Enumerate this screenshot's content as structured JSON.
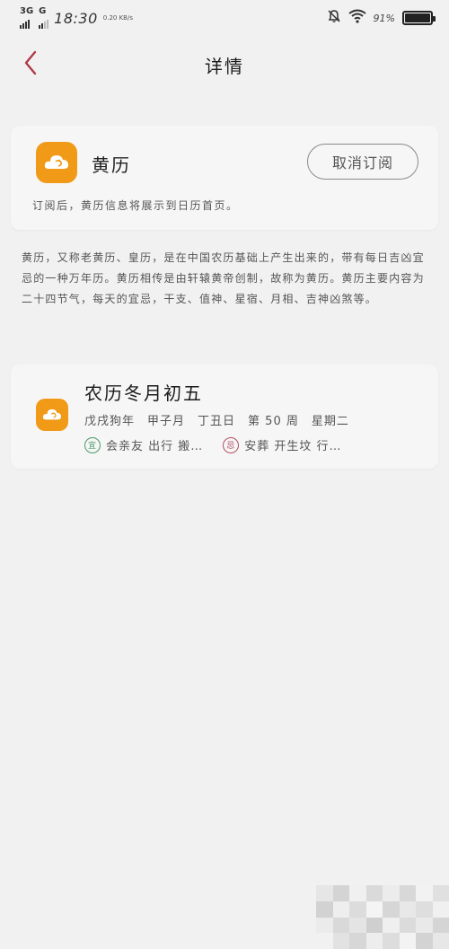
{
  "status_bar": {
    "network": "3G",
    "network2": "G",
    "time": "18:30",
    "speed": "0.20 KB/s",
    "battery": "91%"
  },
  "header": {
    "title": "详情",
    "back_icon": "chevron-left-icon"
  },
  "subscription": {
    "app_name": "黄历",
    "unsubscribe_label": "取消订阅",
    "note": "订阅后，黄历信息将展示到日历首页。"
  },
  "description": "黄历，又称老黄历、皇历，是在中国农历基础上产生出来的，带有每日吉凶宜忌的一种万年历。黄历相传是由轩辕黄帝创制，故称为黄历。黄历主要内容为二十四节气，每天的宜忌，干支、值神、星宿、月相、吉神凶煞等。",
  "almanac": {
    "lunar_date": "农历冬月初五",
    "year": "戊戌狗年",
    "month": "甲子月",
    "day": "丁丑日",
    "week": "第 50 周",
    "weekday": "星期二",
    "yi_badge": "宜",
    "yi_text": "会亲友 出行 搬…",
    "ji_badge": "忌",
    "ji_text": "安葬 开生坟 行…"
  },
  "colors": {
    "accent": "#b03a48",
    "app_icon": "#f09a17",
    "yi": "#4a9a6a",
    "ji": "#b05060"
  }
}
